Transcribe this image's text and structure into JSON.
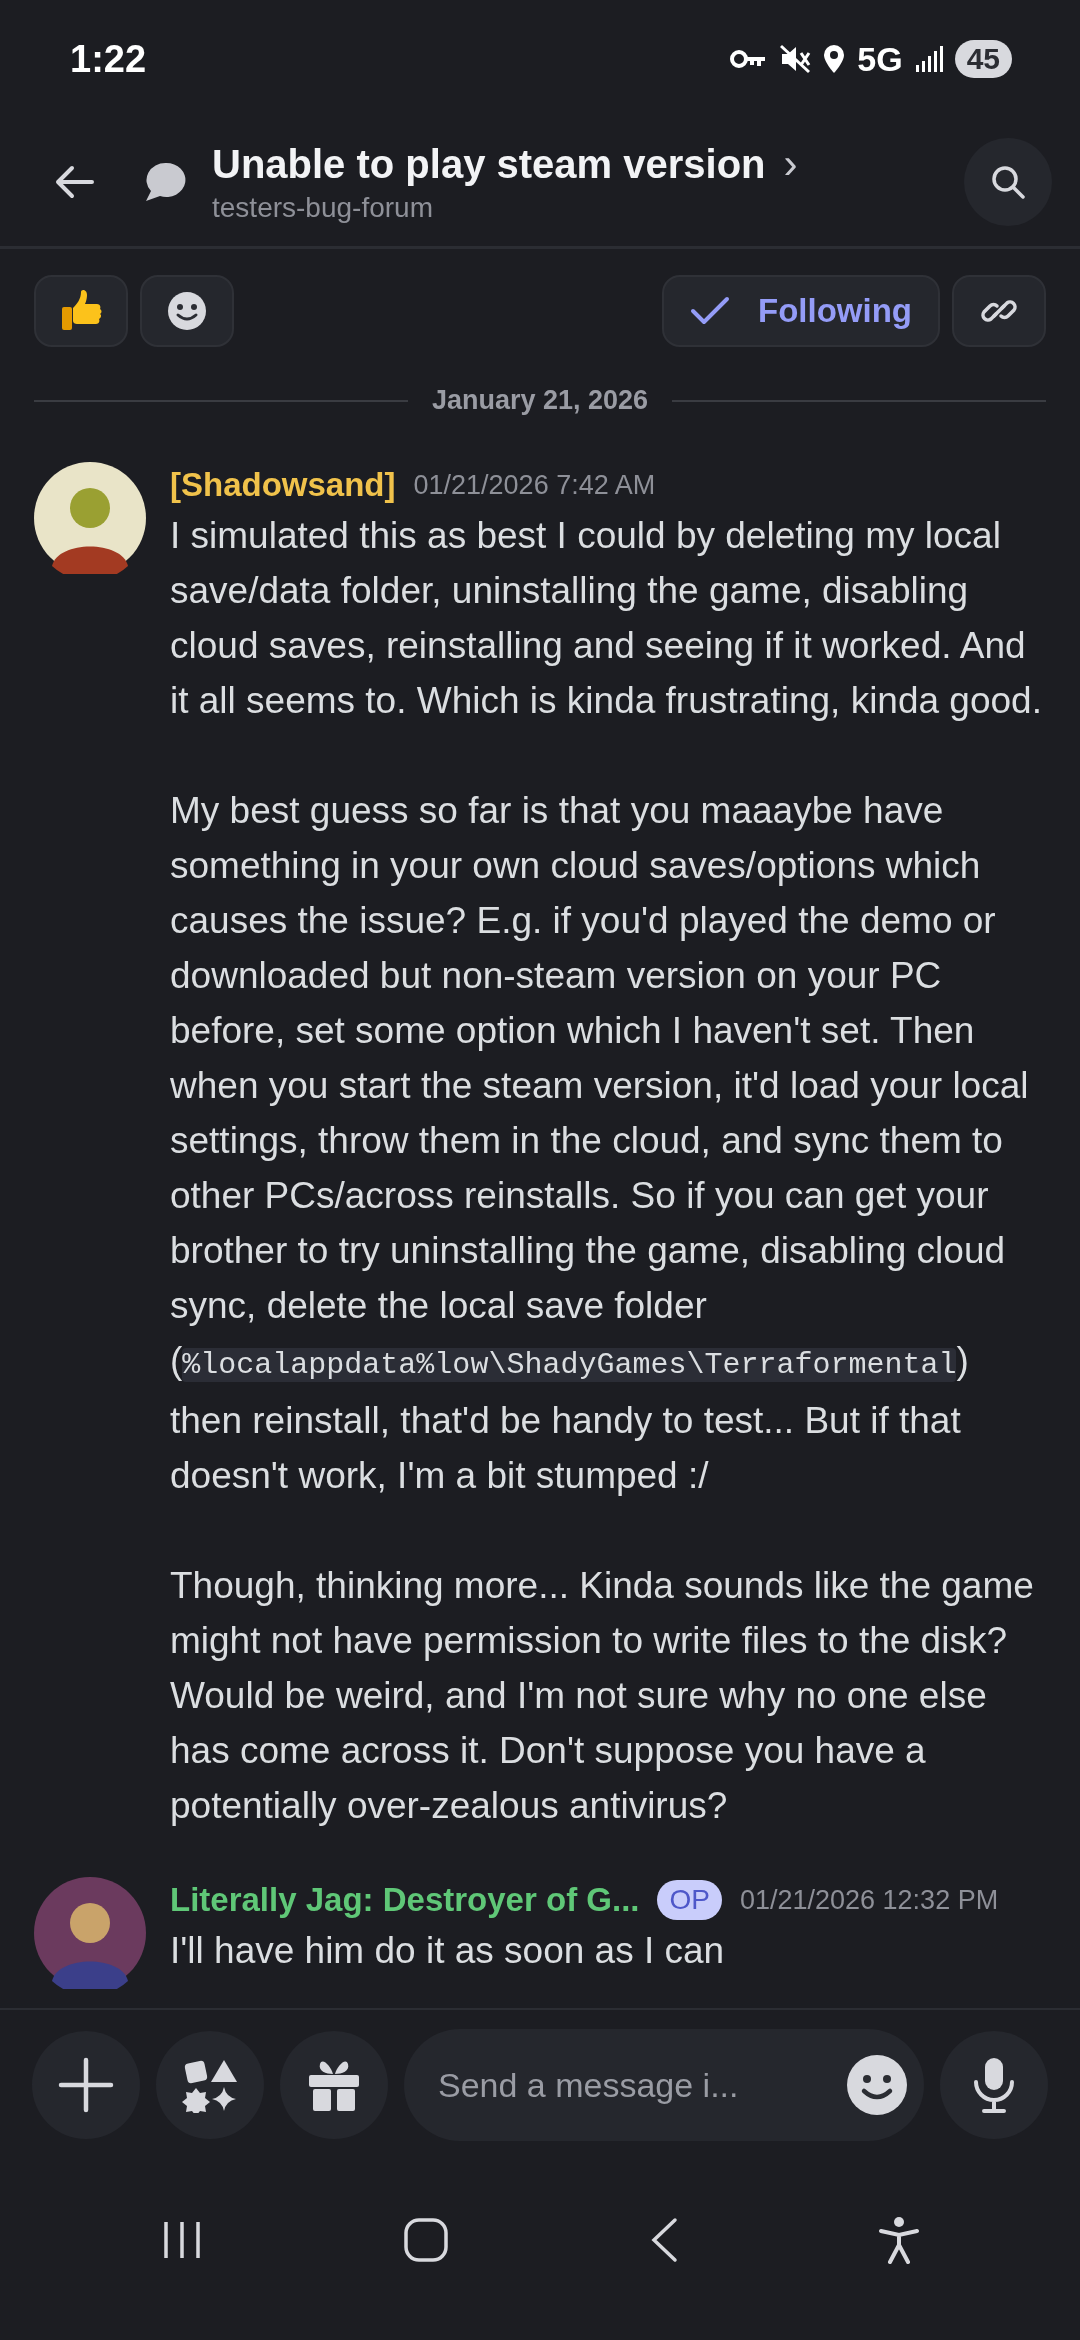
{
  "status_bar": {
    "time": "1:22",
    "network": "5G",
    "battery": "45"
  },
  "header": {
    "title": "Unable to play steam version",
    "chevron": "›",
    "channel": "testers-bug-forum"
  },
  "actions": {
    "following": {
      "label": "Following",
      "on": true
    }
  },
  "date_divider": "January 21, 2026",
  "messages": [
    {
      "author": "[Shadowsand]",
      "color": "#f0c24b",
      "op": false,
      "time": "01/21/2026 7:42 AM",
      "paragraphs": [
        [
          {
            "kind": "text",
            "text": "I simulated this as best I could by deleting my local save/data folder, uninstalling the game, disabling cloud saves, reinstalling and seeing if it worked. And it all seems to. Which is kinda frustrating, kinda good."
          }
        ],
        [
          {
            "kind": "text",
            "text": "My best guess so far is that you maaaybe have something in your own cloud saves/options which causes the issue? E.g. if you'd played the demo or downloaded but non-steam version on your PC before, set some option which I haven't set. Then when you start the steam version, it'd load your local settings, throw them in the cloud, and sync them to other PCs/across reinstalls. So if you can get your brother to try uninstalling the game, disabling cloud sync, delete the local save folder ("
          },
          {
            "kind": "code",
            "text": "%localappdata%low\\ShadyGames\\Terraformental"
          },
          {
            "kind": "text",
            "text": ") then reinstall, that'd be handy to test... But if that doesn't work, I'm a bit stumped :/"
          }
        ],
        [
          {
            "kind": "text",
            "text": "Though, thinking more... Kinda sounds like the game might not have permission to write files to the disk? Would be weird, and I'm not sure why no one else has come across it. Don't suppose you have a potentially over-zealous antivirus?"
          }
        ]
      ]
    },
    {
      "author": "Literally Jag: Destroyer of G...",
      "color": "#5fc777",
      "op": true,
      "op_label": "OP",
      "time": "01/21/2026 12:32 PM",
      "paragraphs": [
        [
          {
            "kind": "text",
            "text": "I'll have him do it as soon as I can"
          }
        ]
      ]
    }
  ],
  "composer": {
    "placeholder": "Send a message i..."
  }
}
